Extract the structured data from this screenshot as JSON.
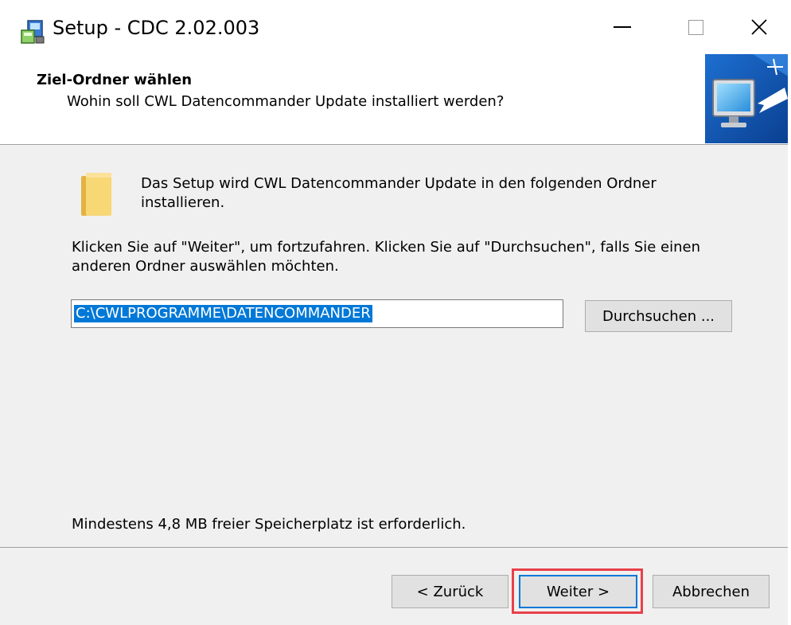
{
  "window": {
    "title": "Setup - CDC 2.02.003",
    "controls": {
      "minimize": "minimize",
      "maximize": "maximize",
      "close": "close"
    }
  },
  "header": {
    "title": "Ziel-Ordner wählen",
    "subtitle": "Wohin soll CWL Datencommander Update installiert werden?"
  },
  "content": {
    "info": "Das Setup wird CWL Datencommander Update in den folgenden Ordner installieren.",
    "instruction": "Klicken Sie auf \"Weiter\", um fortzufahren. Klicken Sie auf \"Durchsuchen\", falls Sie einen anderen Ordner auswählen möchten.",
    "path_value": "C:\\CWLPROGRAMME\\DATENCOMMANDER",
    "browse_label": "Durchsuchen ...",
    "space_required": "Mindestens 4,8 MB freier Speicherplatz ist erforderlich."
  },
  "footer": {
    "back_label": "< Zurück",
    "next_label": "Weiter >",
    "cancel_label": "Abbrechen"
  },
  "icons": {
    "app": "installer-icon",
    "folder": "folder-icon",
    "header_art": "monitor-install-icon"
  },
  "colors": {
    "selection": "#0078d7",
    "highlight": "#e8404a",
    "dialog_bg": "#f0f0f0"
  }
}
